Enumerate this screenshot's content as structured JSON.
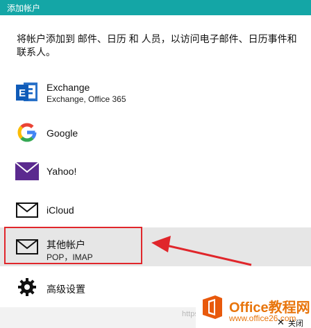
{
  "window": {
    "title": "添加帐户"
  },
  "description": "将帐户添加到 邮件、日历 和 人员，以访问电子邮件、日历事件和联系人。",
  "accounts": [
    {
      "name": "Exchange",
      "sub": "Exchange, Office 365",
      "icon": "exchange-icon"
    },
    {
      "name": "Google",
      "sub": "",
      "icon": "google-icon"
    },
    {
      "name": "Yahoo!",
      "sub": "",
      "icon": "yahoo-mail-icon"
    },
    {
      "name": "iCloud",
      "sub": "",
      "icon": "mail-envelope-icon"
    },
    {
      "name": "其他帐户",
      "sub": "POP，IMAP",
      "icon": "mail-envelope-icon"
    },
    {
      "name": "高级设置",
      "sub": "",
      "icon": "gear-icon"
    }
  ],
  "watermark": "https://blog.csdn",
  "brand": {
    "name": "Office教程网",
    "url": "www.office26.com"
  },
  "footer": {
    "close_label": "关闭"
  },
  "colors": {
    "titlebar": "#14a6a6",
    "highlight": "#e0262b",
    "brand": "#e8750c"
  }
}
